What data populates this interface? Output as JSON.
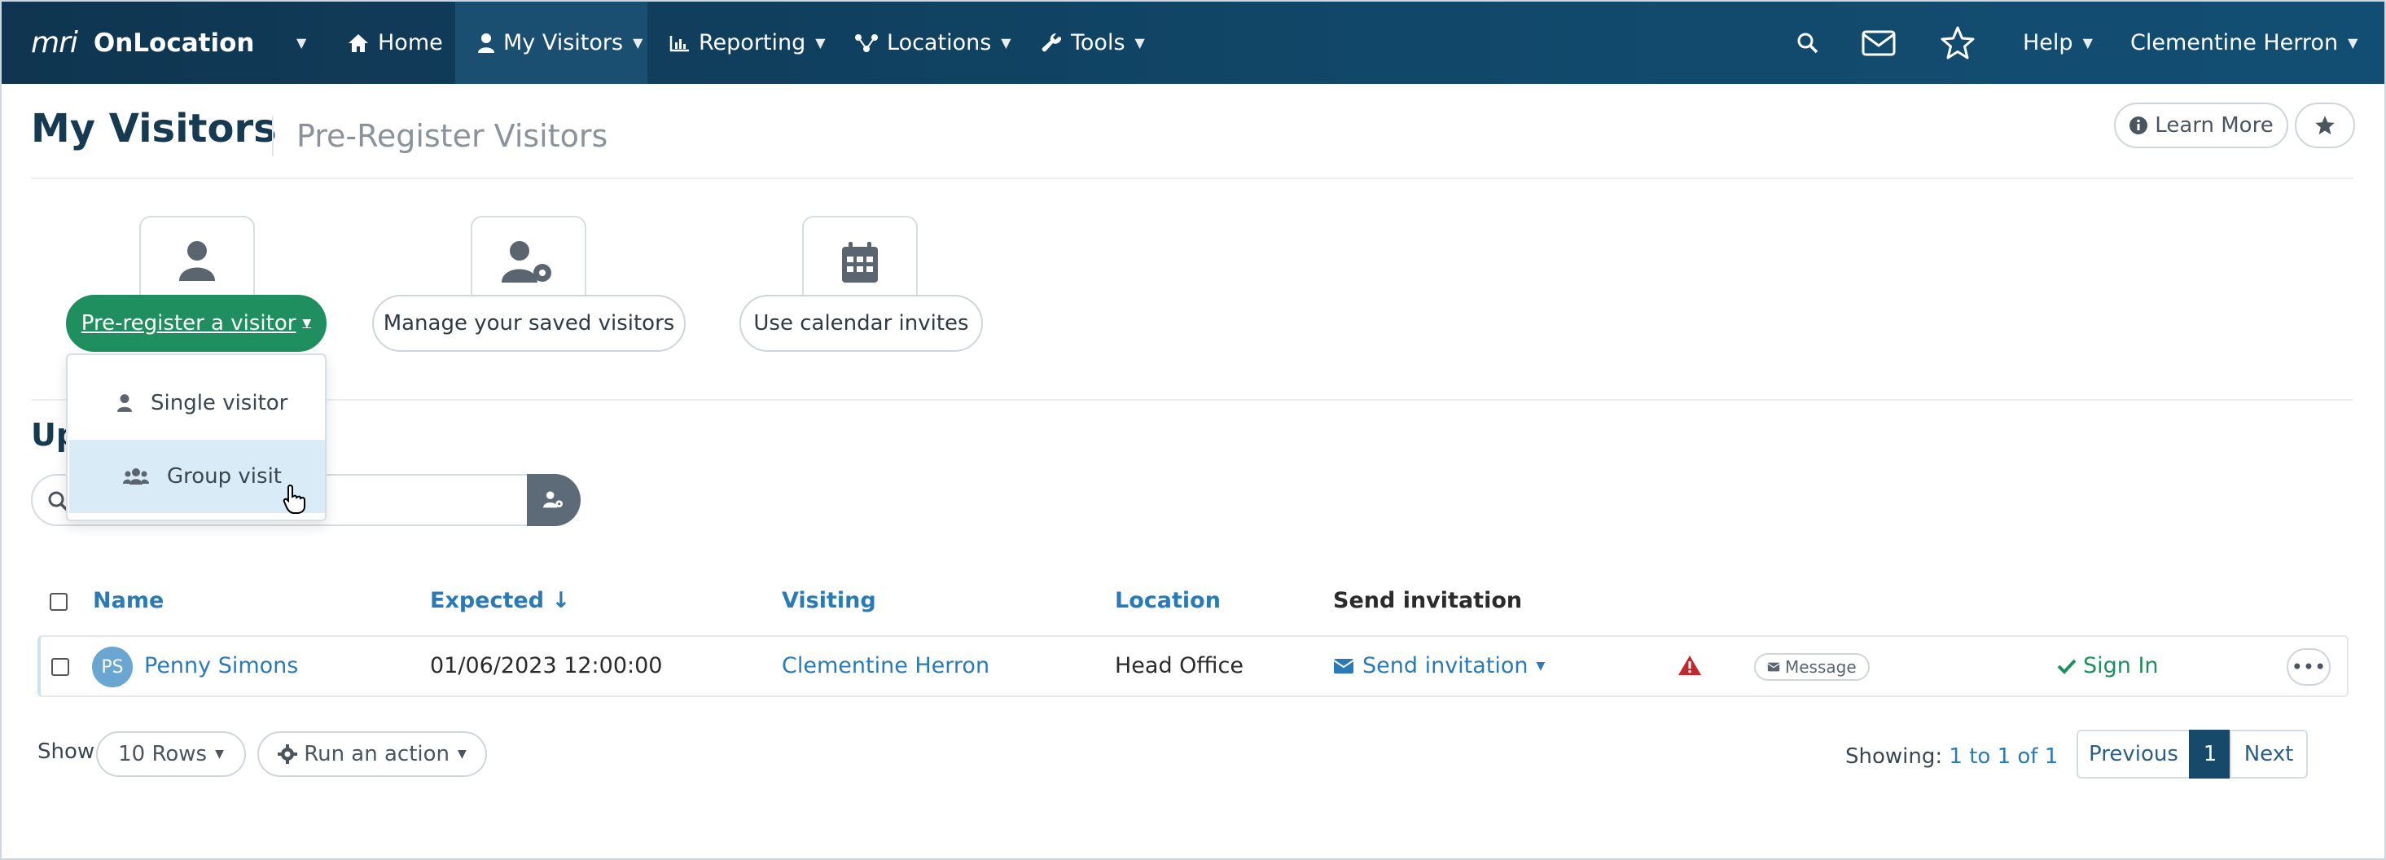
{
  "nav": {
    "brand_logo": "mri",
    "brand_name": "OnLocation",
    "items": [
      {
        "label": "Home",
        "icon": "home-icon"
      },
      {
        "label": "My Visitors",
        "icon": "user-icon"
      },
      {
        "label": "Reporting",
        "icon": "chart-icon"
      },
      {
        "label": "Locations",
        "icon": "network-icon"
      },
      {
        "label": "Tools",
        "icon": "wrench-icon"
      }
    ],
    "help": "Help",
    "user": "Clementine Herron"
  },
  "header": {
    "title": "My Visitors",
    "subtitle": "Pre-Register Visitors",
    "learn_more": "Learn More"
  },
  "actions": {
    "preregister": "Pre-register a visitor",
    "manage": "Manage your saved visitors",
    "calendar": "Use calendar invites"
  },
  "dropdown": {
    "single": "Single visitor",
    "group": "Group visit"
  },
  "section": {
    "title_visible": "Up"
  },
  "table": {
    "headers": {
      "name": "Name",
      "expected": "Expected ↓",
      "visiting": "Visiting",
      "location": "Location",
      "send_invitation": "Send invitation"
    },
    "rows": [
      {
        "initials": "PS",
        "name": "Penny Simons",
        "expected": "01/06/2023 12:00:00",
        "visiting": "Clementine Herron",
        "location": "Head Office",
        "send_invitation": "Send invitation",
        "message": "Message",
        "sign_in": "Sign In"
      }
    ]
  },
  "footer": {
    "show_label": "Show",
    "rows_select": "10 Rows",
    "run_action": "Run an action",
    "showing_label": "Showing:",
    "showing_value": "1 to 1 of 1",
    "previous": "Previous",
    "page": "1",
    "next": "Next"
  },
  "colors": {
    "nav_bg": "#11486a",
    "primary_green": "#1f8f5f",
    "link_blue": "#2a7ab8",
    "warning_red": "#c0282d"
  }
}
